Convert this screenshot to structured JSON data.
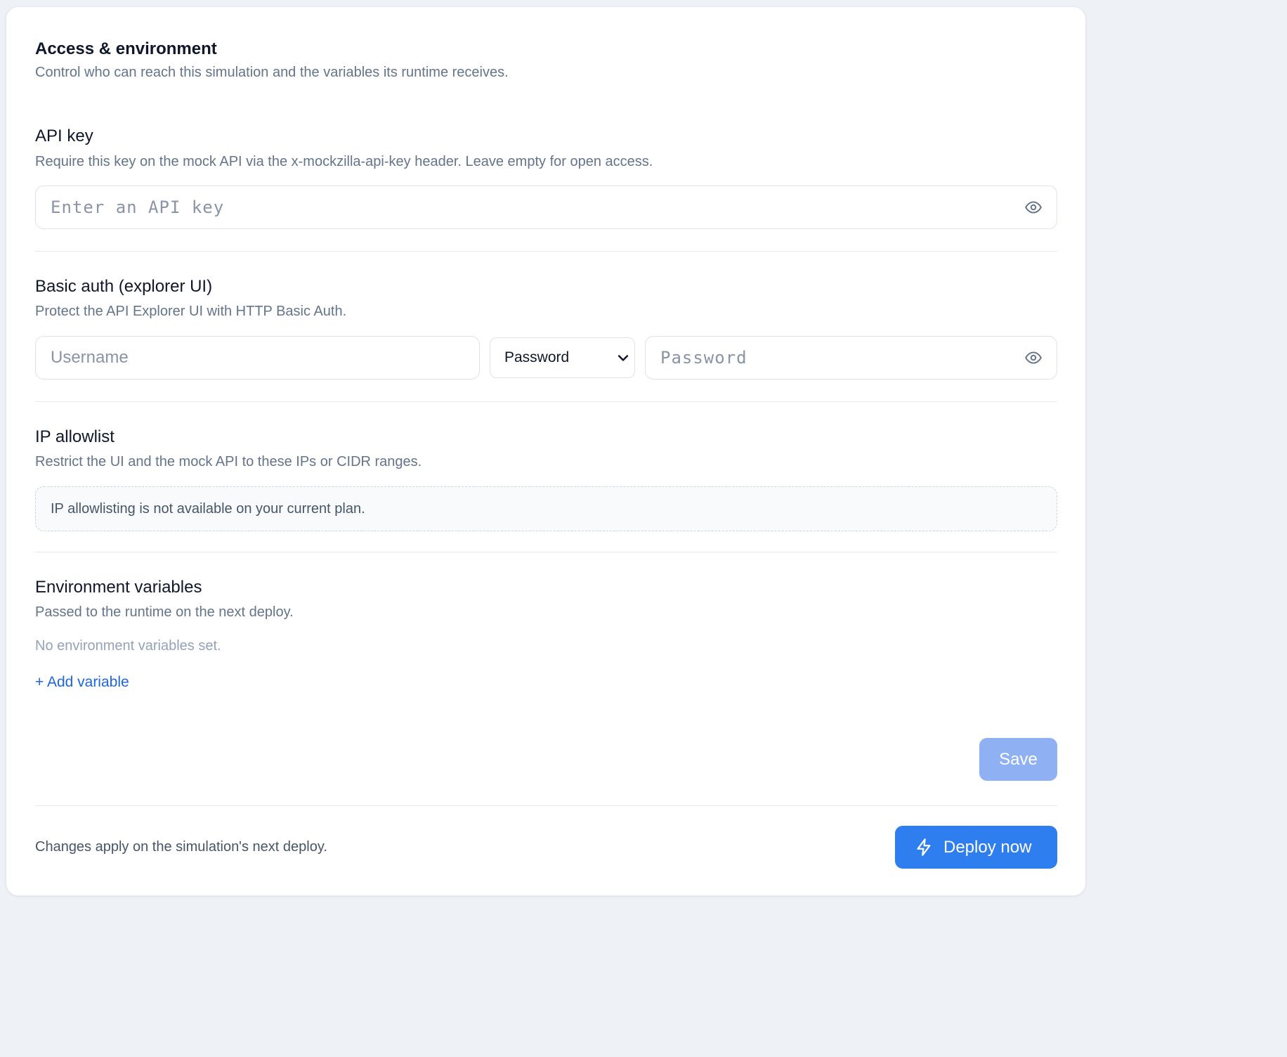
{
  "header": {
    "title": "Access & environment",
    "subtitle": "Control who can reach this simulation and the variables its runtime receives."
  },
  "api_key": {
    "title": "API key",
    "description": "Require this key on the mock API via the x-mockzilla-api-key header. Leave empty for open access.",
    "placeholder": "Enter an API key",
    "value": ""
  },
  "basic_auth": {
    "title": "Basic auth (explorer UI)",
    "description": "Protect the API Explorer UI with HTTP Basic Auth.",
    "username_placeholder": "Username",
    "username_value": "",
    "mode_selected": "Password",
    "password_placeholder": "Password",
    "password_value": ""
  },
  "ip_allowlist": {
    "title": "IP allowlist",
    "description": "Restrict the UI and the mock API to these IPs or CIDR ranges.",
    "notice": "IP allowlisting is not available on your current plan."
  },
  "env_vars": {
    "title": "Environment variables",
    "description": "Passed to the runtime on the next deploy.",
    "empty_text": "No environment variables set.",
    "add_label": "+ Add variable"
  },
  "actions": {
    "save_label": "Save"
  },
  "footer": {
    "note": "Changes apply on the simulation's next deploy.",
    "deploy_label": "Deploy now"
  },
  "colors": {
    "accent": "#2f7ef0",
    "accent_disabled": "#8fb1f4",
    "link": "#1d66e0",
    "muted_text": "#64748b"
  },
  "icons": {
    "password_toggle": "eye-icon",
    "dropdown": "chevron-down-icon",
    "deploy": "lightning-icon"
  }
}
